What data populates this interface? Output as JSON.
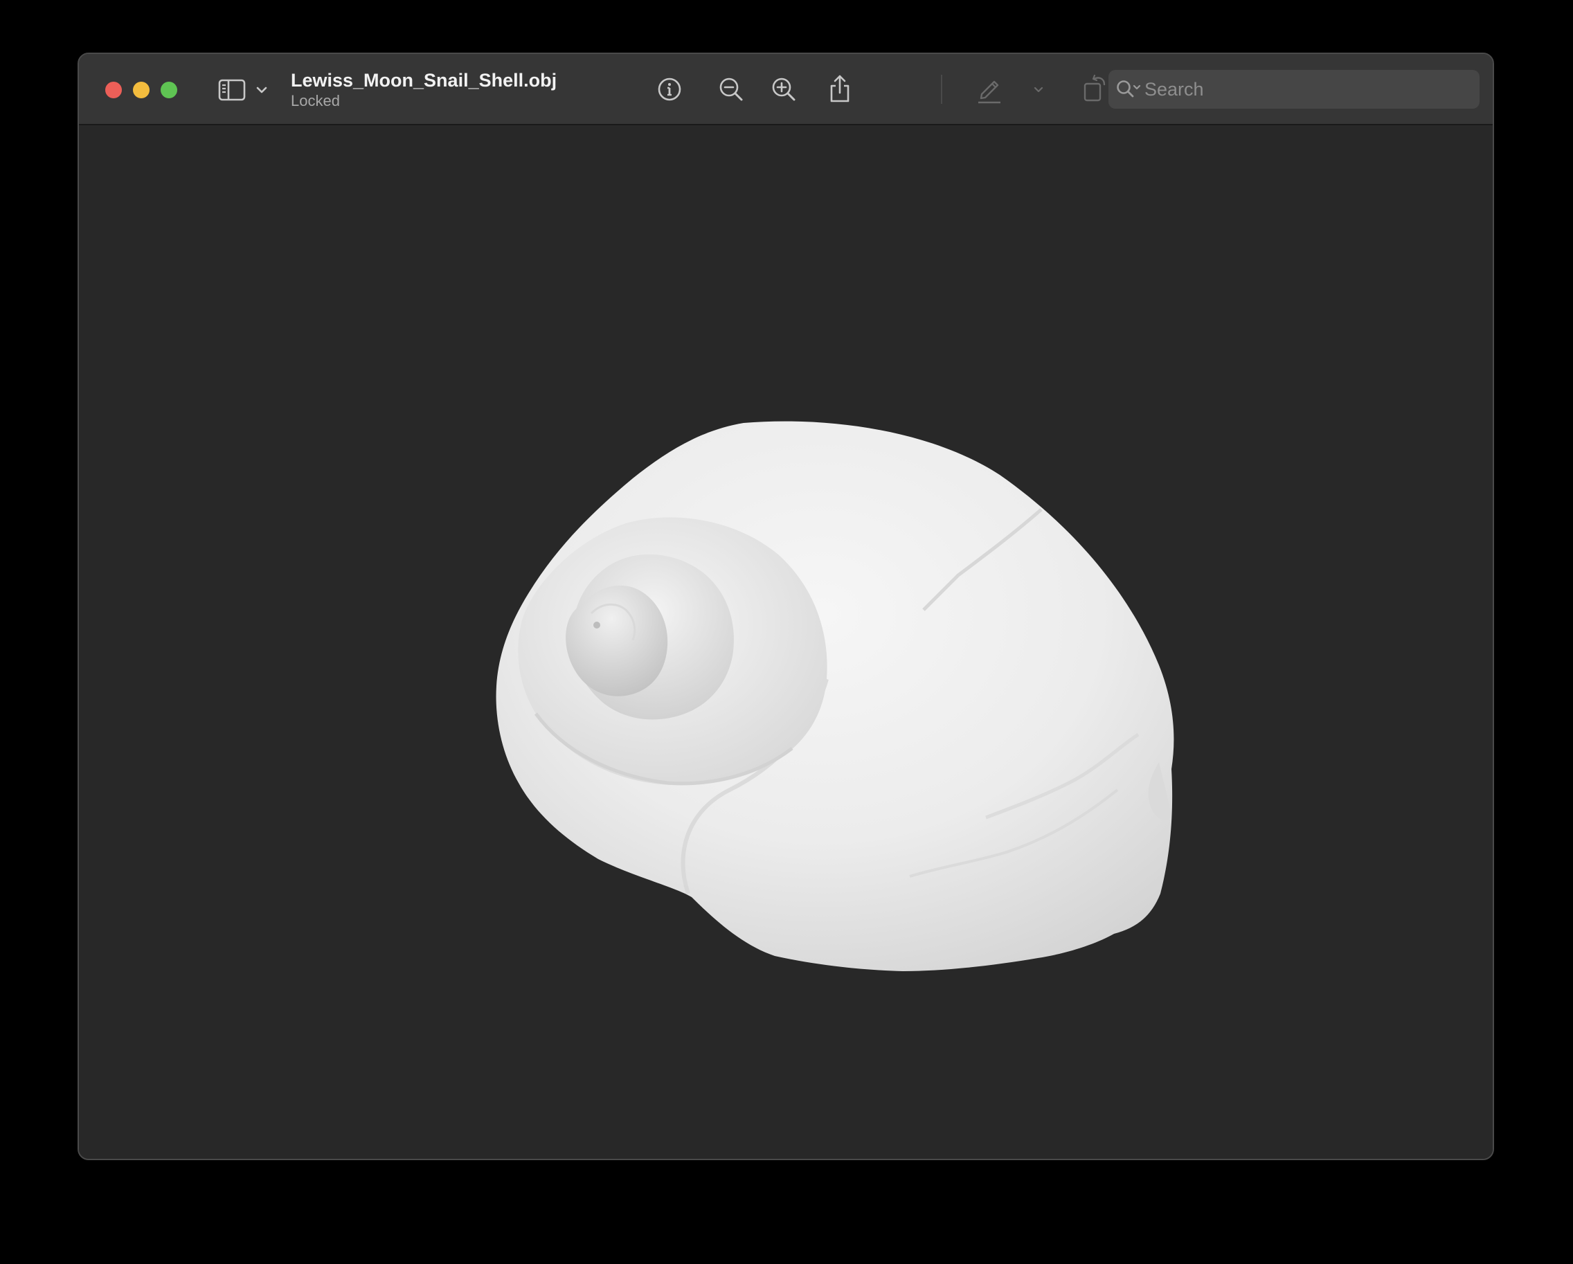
{
  "window": {
    "title": "Lewiss_Moon_Snail_Shell.obj",
    "subtitle": "Locked"
  },
  "toolbar": {
    "icons": [
      "sidebar-icon",
      "chevron-down-icon",
      "info-icon",
      "zoom-out-icon",
      "zoom-in-icon",
      "share-icon",
      "markup-pen-icon",
      "chevron-down-icon",
      "rotate-icon",
      "annotate-icon"
    ]
  },
  "search": {
    "placeholder": "Search"
  },
  "viewer": {
    "content": "3d-model-snail-shell"
  },
  "colors": {
    "close": "#ec5f58",
    "minimize": "#f3bc3e",
    "maximize": "#5fc453",
    "viewport_bg": "#282828",
    "titlebar_bg": "#363636"
  }
}
